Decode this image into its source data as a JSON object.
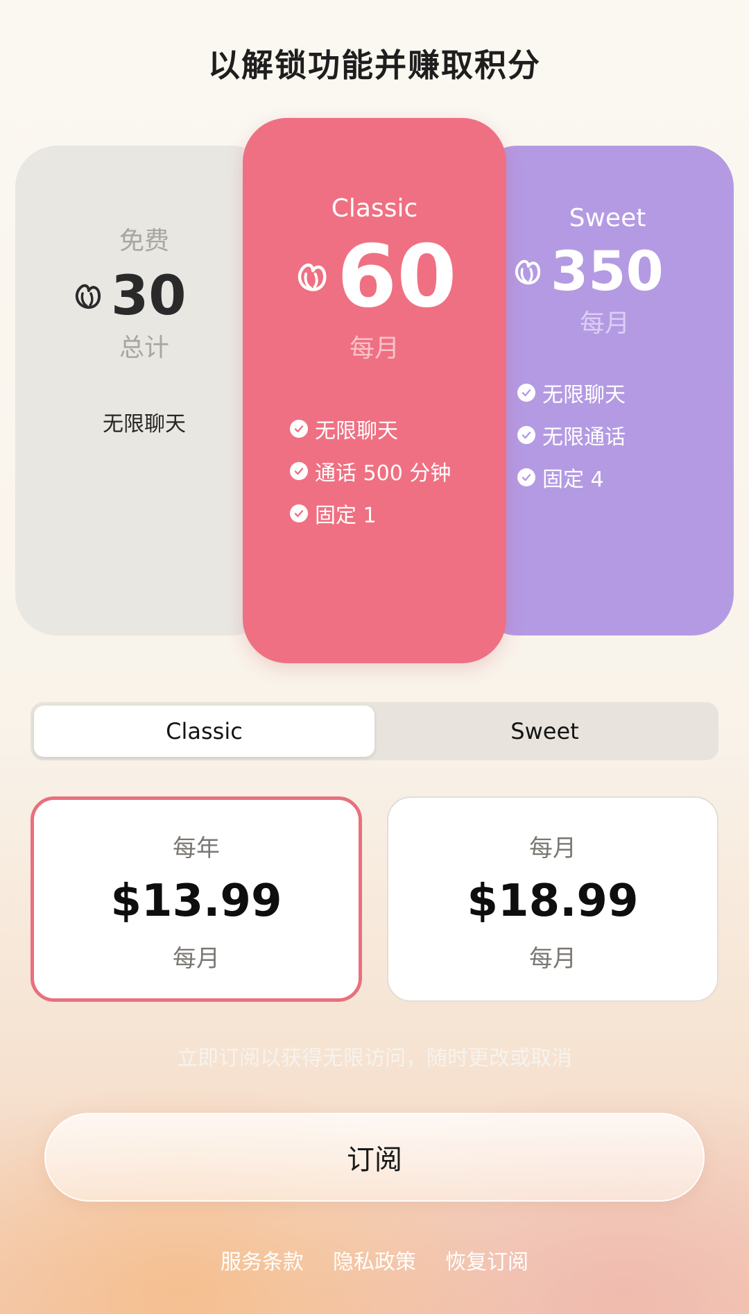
{
  "header": {
    "title": "以解锁功能并赚取积分"
  },
  "plans": {
    "free": {
      "name": "免费",
      "credits": "30",
      "period": "总计",
      "feature": "无限聊天"
    },
    "classic": {
      "name": "Classic",
      "credits": "60",
      "period": "每月",
      "features": [
        "无限聊天",
        "通话 500 分钟",
        "固定 1"
      ]
    },
    "sweet": {
      "name": "Sweet",
      "credits": "350",
      "period": "每月",
      "features": [
        "无限聊天",
        "无限通话",
        "固定 4"
      ]
    }
  },
  "tabs": {
    "classic": "Classic",
    "sweet": "Sweet",
    "selected": "Classic"
  },
  "pricing": {
    "annual": {
      "label": "每年",
      "price": "$13.99",
      "sub": "每月",
      "selected": true
    },
    "monthly": {
      "label": "每月",
      "price": "$18.99",
      "sub": "每月",
      "selected": false
    }
  },
  "notice": "立即订阅以获得无限访问，随时更改或取消",
  "subscribe_label": "订阅",
  "footer": {
    "terms": "服务条款",
    "privacy": "隐私政策",
    "restore": "恢复订阅"
  },
  "colors": {
    "classic": "#ef7082",
    "sweet": "#b49ae3",
    "free": "#e9e7e2",
    "selected_border": "#e8707d"
  },
  "icons": {
    "credit": "seed-icon",
    "feature": "check-icon"
  }
}
